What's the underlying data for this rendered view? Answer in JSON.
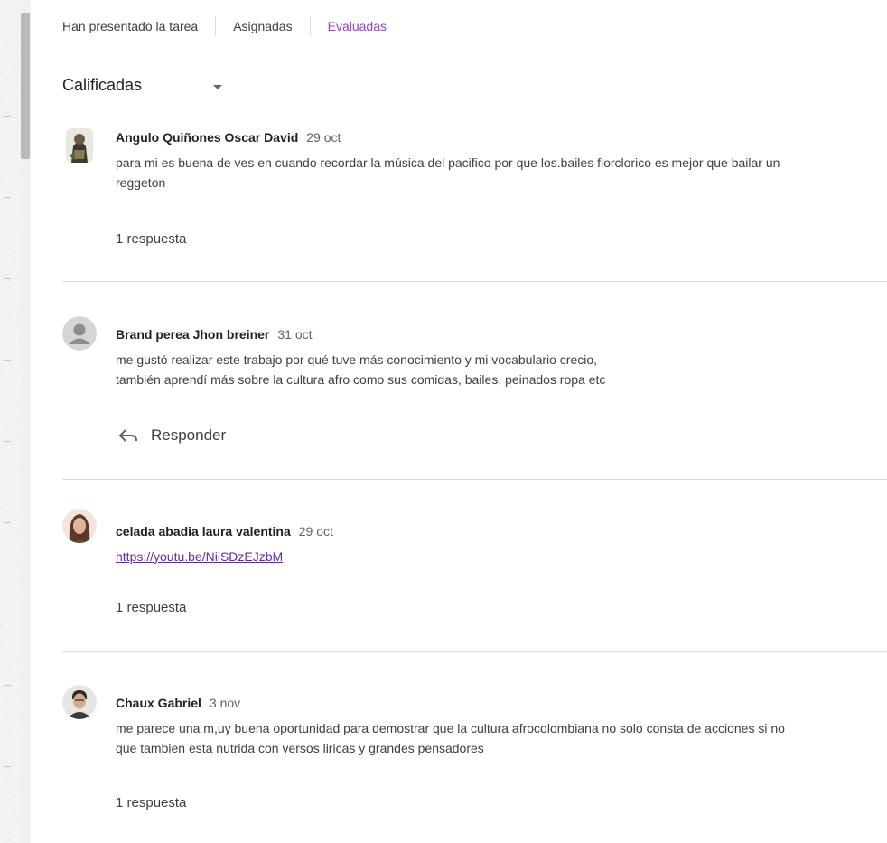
{
  "tabs": {
    "submitted": "Han presentado la tarea",
    "assigned": "Asignadas",
    "graded": "Evaluadas"
  },
  "filter": {
    "label": "Calificadas"
  },
  "comments": [
    {
      "author": "Angulo Quiñones Oscar David",
      "date": "29 oct",
      "lines": [
        "para mi es buena de ves en cuando recordar la música del pacifico por que los.bailes florclorico es mejor que bailar un",
        "reggeton"
      ],
      "replies": "1 respuesta"
    },
    {
      "author": "Brand perea Jhon breiner",
      "date": "31 oct",
      "lines": [
        "me gustó realizar este trabajo por qué tuve más conocimiento y mi vocabulario crecio,",
        "también aprendí más sobre la cultura afro como sus comidas, bailes, peinados ropa etc"
      ],
      "reply_label": "Responder"
    },
    {
      "author": "celada abadia laura valentina",
      "date": "29 oct",
      "link": "https://youtu.be/NiiSDzEJzbM",
      "replies": "1 respuesta"
    },
    {
      "author": "Chaux Gabriel",
      "date": "3 nov",
      "lines": [
        "me parece una m,uy buena oportunidad para demostrar que la cultura afrocolombiana no solo consta de acciones si no",
        "que tambien esta nutrida con versos liricas y grandes pensadores"
      ],
      "replies": "1 respuesta"
    }
  ],
  "colors": {
    "active_tab": "#8e44c8",
    "link": "#5b2dab",
    "divider": "#dadce0"
  },
  "icons": {
    "dropdown": "caret-down-icon",
    "reply": "reply-arrow-icon"
  }
}
